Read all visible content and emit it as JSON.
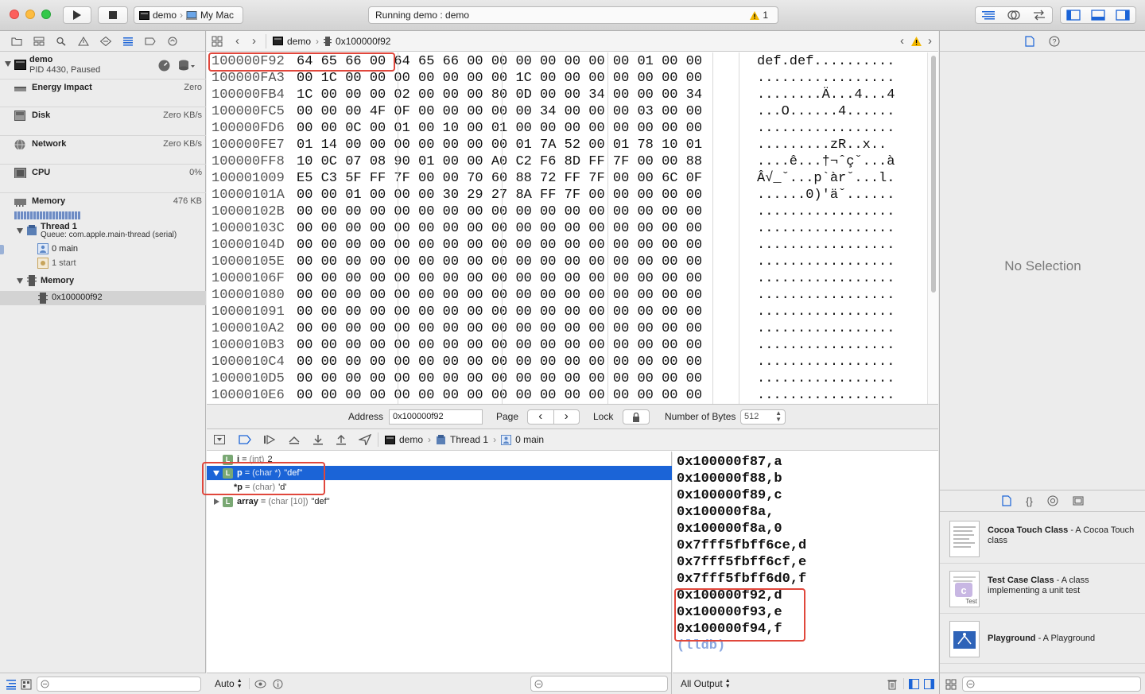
{
  "toolbar": {
    "scheme": "demo",
    "destination": "My Mac",
    "status": "Running demo : demo",
    "warning_count": "1"
  },
  "navigator": {
    "process_name": "demo",
    "process_detail": "PID 4430, Paused",
    "gauges": [
      {
        "title": "Energy Impact",
        "value": "Zero"
      },
      {
        "title": "Disk",
        "value": "Zero KB/s"
      },
      {
        "title": "Network",
        "value": "Zero KB/s"
      },
      {
        "title": "CPU",
        "value": "0%"
      },
      {
        "title": "Memory",
        "value": "476 KB"
      }
    ],
    "thread_title": "Thread 1",
    "thread_queue": "Queue: com.apple.main-thread (serial)",
    "frames": [
      "0 main",
      "1 start"
    ],
    "memory_group": "Memory",
    "memory_item": "0x100000f92",
    "filter_placeholder": ""
  },
  "editor": {
    "breadcrumb": [
      "demo",
      "0x100000f92"
    ],
    "hex_rows": [
      {
        "addr": "100000F92",
        "bytes": "64 65 66 00 64 65 66 00 00 00 00 00 00 00 01 00 00",
        "ascii": "def.def.........."
      },
      {
        "addr": "100000FA3",
        "bytes": "00 1C 00 00 00 00 00 00 00 1C 00 00 00 00 00 00 00",
        "ascii": "................."
      },
      {
        "addr": "100000FB4",
        "bytes": "1C 00 00 00 02 00 00 00 80 0D 00 00 34 00 00 00 34",
        "ascii": "........Ä...4...4"
      },
      {
        "addr": "100000FC5",
        "bytes": "00 00 00 4F 0F 00 00 00 00 00 34 00 00 00 03 00 00",
        "ascii": "...O......4......"
      },
      {
        "addr": "100000FD6",
        "bytes": "00 00 0C 00 01 00 10 00 01 00 00 00 00 00 00 00 00",
        "ascii": "................."
      },
      {
        "addr": "100000FE7",
        "bytes": "01 14 00 00 00 00 00 00 00 01 7A 52 00 01 78 10 01",
        "ascii": ".........zR..x.."
      },
      {
        "addr": "100000FF8",
        "bytes": "10 0C 07 08 90 01 00 00 A0 C2 F6 8D FF 7F 00 00 88",
        "ascii": "....ê...†¬ˆçˇ...à"
      },
      {
        "addr": "100001009",
        "bytes": "E5 C3 5F FF 7F 00 00 70 60 88 72 FF 7F 00 00 6C 0F",
        "ascii": "Â√_ˇ...p`àrˇ...l."
      },
      {
        "addr": "10000101A",
        "bytes": "00 00 01 00 00 00 30 29 27 8A FF 7F 00 00 00 00 00",
        "ascii": "......0)'äˇ......"
      },
      {
        "addr": "10000102B",
        "bytes": "00 00 00 00 00 00 00 00 00 00 00 00 00 00 00 00 00",
        "ascii": "................."
      },
      {
        "addr": "10000103C",
        "bytes": "00 00 00 00 00 00 00 00 00 00 00 00 00 00 00 00 00",
        "ascii": "................."
      },
      {
        "addr": "10000104D",
        "bytes": "00 00 00 00 00 00 00 00 00 00 00 00 00 00 00 00 00",
        "ascii": "................."
      },
      {
        "addr": "10000105E",
        "bytes": "00 00 00 00 00 00 00 00 00 00 00 00 00 00 00 00 00",
        "ascii": "................."
      },
      {
        "addr": "10000106F",
        "bytes": "00 00 00 00 00 00 00 00 00 00 00 00 00 00 00 00 00",
        "ascii": "................."
      },
      {
        "addr": "100001080",
        "bytes": "00 00 00 00 00 00 00 00 00 00 00 00 00 00 00 00 00",
        "ascii": "................."
      },
      {
        "addr": "100001091",
        "bytes": "00 00 00 00 00 00 00 00 00 00 00 00 00 00 00 00 00",
        "ascii": "................."
      },
      {
        "addr": "1000010A2",
        "bytes": "00 00 00 00 00 00 00 00 00 00 00 00 00 00 00 00 00",
        "ascii": "................."
      },
      {
        "addr": "1000010B3",
        "bytes": "00 00 00 00 00 00 00 00 00 00 00 00 00 00 00 00 00",
        "ascii": "................."
      },
      {
        "addr": "1000010C4",
        "bytes": "00 00 00 00 00 00 00 00 00 00 00 00 00 00 00 00 00",
        "ascii": "................."
      },
      {
        "addr": "1000010D5",
        "bytes": "00 00 00 00 00 00 00 00 00 00 00 00 00 00 00 00 00",
        "ascii": "................."
      },
      {
        "addr": "1000010E6",
        "bytes": "00 00 00 00 00 00 00 00 00 00 00 00 00 00 00 00 00",
        "ascii": "................."
      }
    ],
    "footer": {
      "address_label": "Address",
      "address_value": "0x100000f92",
      "page_label": "Page",
      "lock_label": "Lock",
      "bytes_label": "Number of Bytes",
      "bytes_value": "512"
    }
  },
  "debugbar": {
    "breadcrumb": [
      "demo",
      "Thread 1",
      "0 main"
    ]
  },
  "variables": {
    "rows": [
      {
        "name": "i",
        "type": "(int)",
        "value": "2"
      },
      {
        "name": "p",
        "type": "(char *)",
        "value": "\"def\""
      },
      {
        "name": "*p",
        "type": "(char)",
        "value": "'d'"
      },
      {
        "name": "array",
        "type": "(char [10])",
        "value": "\"def\""
      }
    ],
    "auto_label": "Auto"
  },
  "console": {
    "lines": [
      "0x100000f87,a",
      "0x100000f88,b",
      "0x100000f89,c",
      "0x100000f8a,",
      "0x100000f8a,0",
      "0x7fff5fbff6ce,d",
      "0x7fff5fbff6cf,e",
      "0x7fff5fbff6d0,f",
      "0x100000f92,d",
      "0x100000f93,e",
      "0x100000f94,f"
    ],
    "prompt": "(lldb)",
    "output_label": "All Output"
  },
  "inspector": {
    "empty_text": "No Selection",
    "library": [
      {
        "title": "Cocoa Touch Class",
        "desc": " - A Cocoa Touch class"
      },
      {
        "title": "Test Case Class",
        "desc": " - A class implementing a unit test"
      },
      {
        "title": "Playground",
        "desc": " - A Playground"
      }
    ],
    "test_badge": "Test"
  },
  "colors": {
    "accent": "#1b64d7",
    "highlight_box": "#e0473c",
    "lldb_prompt": "#8aa7e0"
  }
}
